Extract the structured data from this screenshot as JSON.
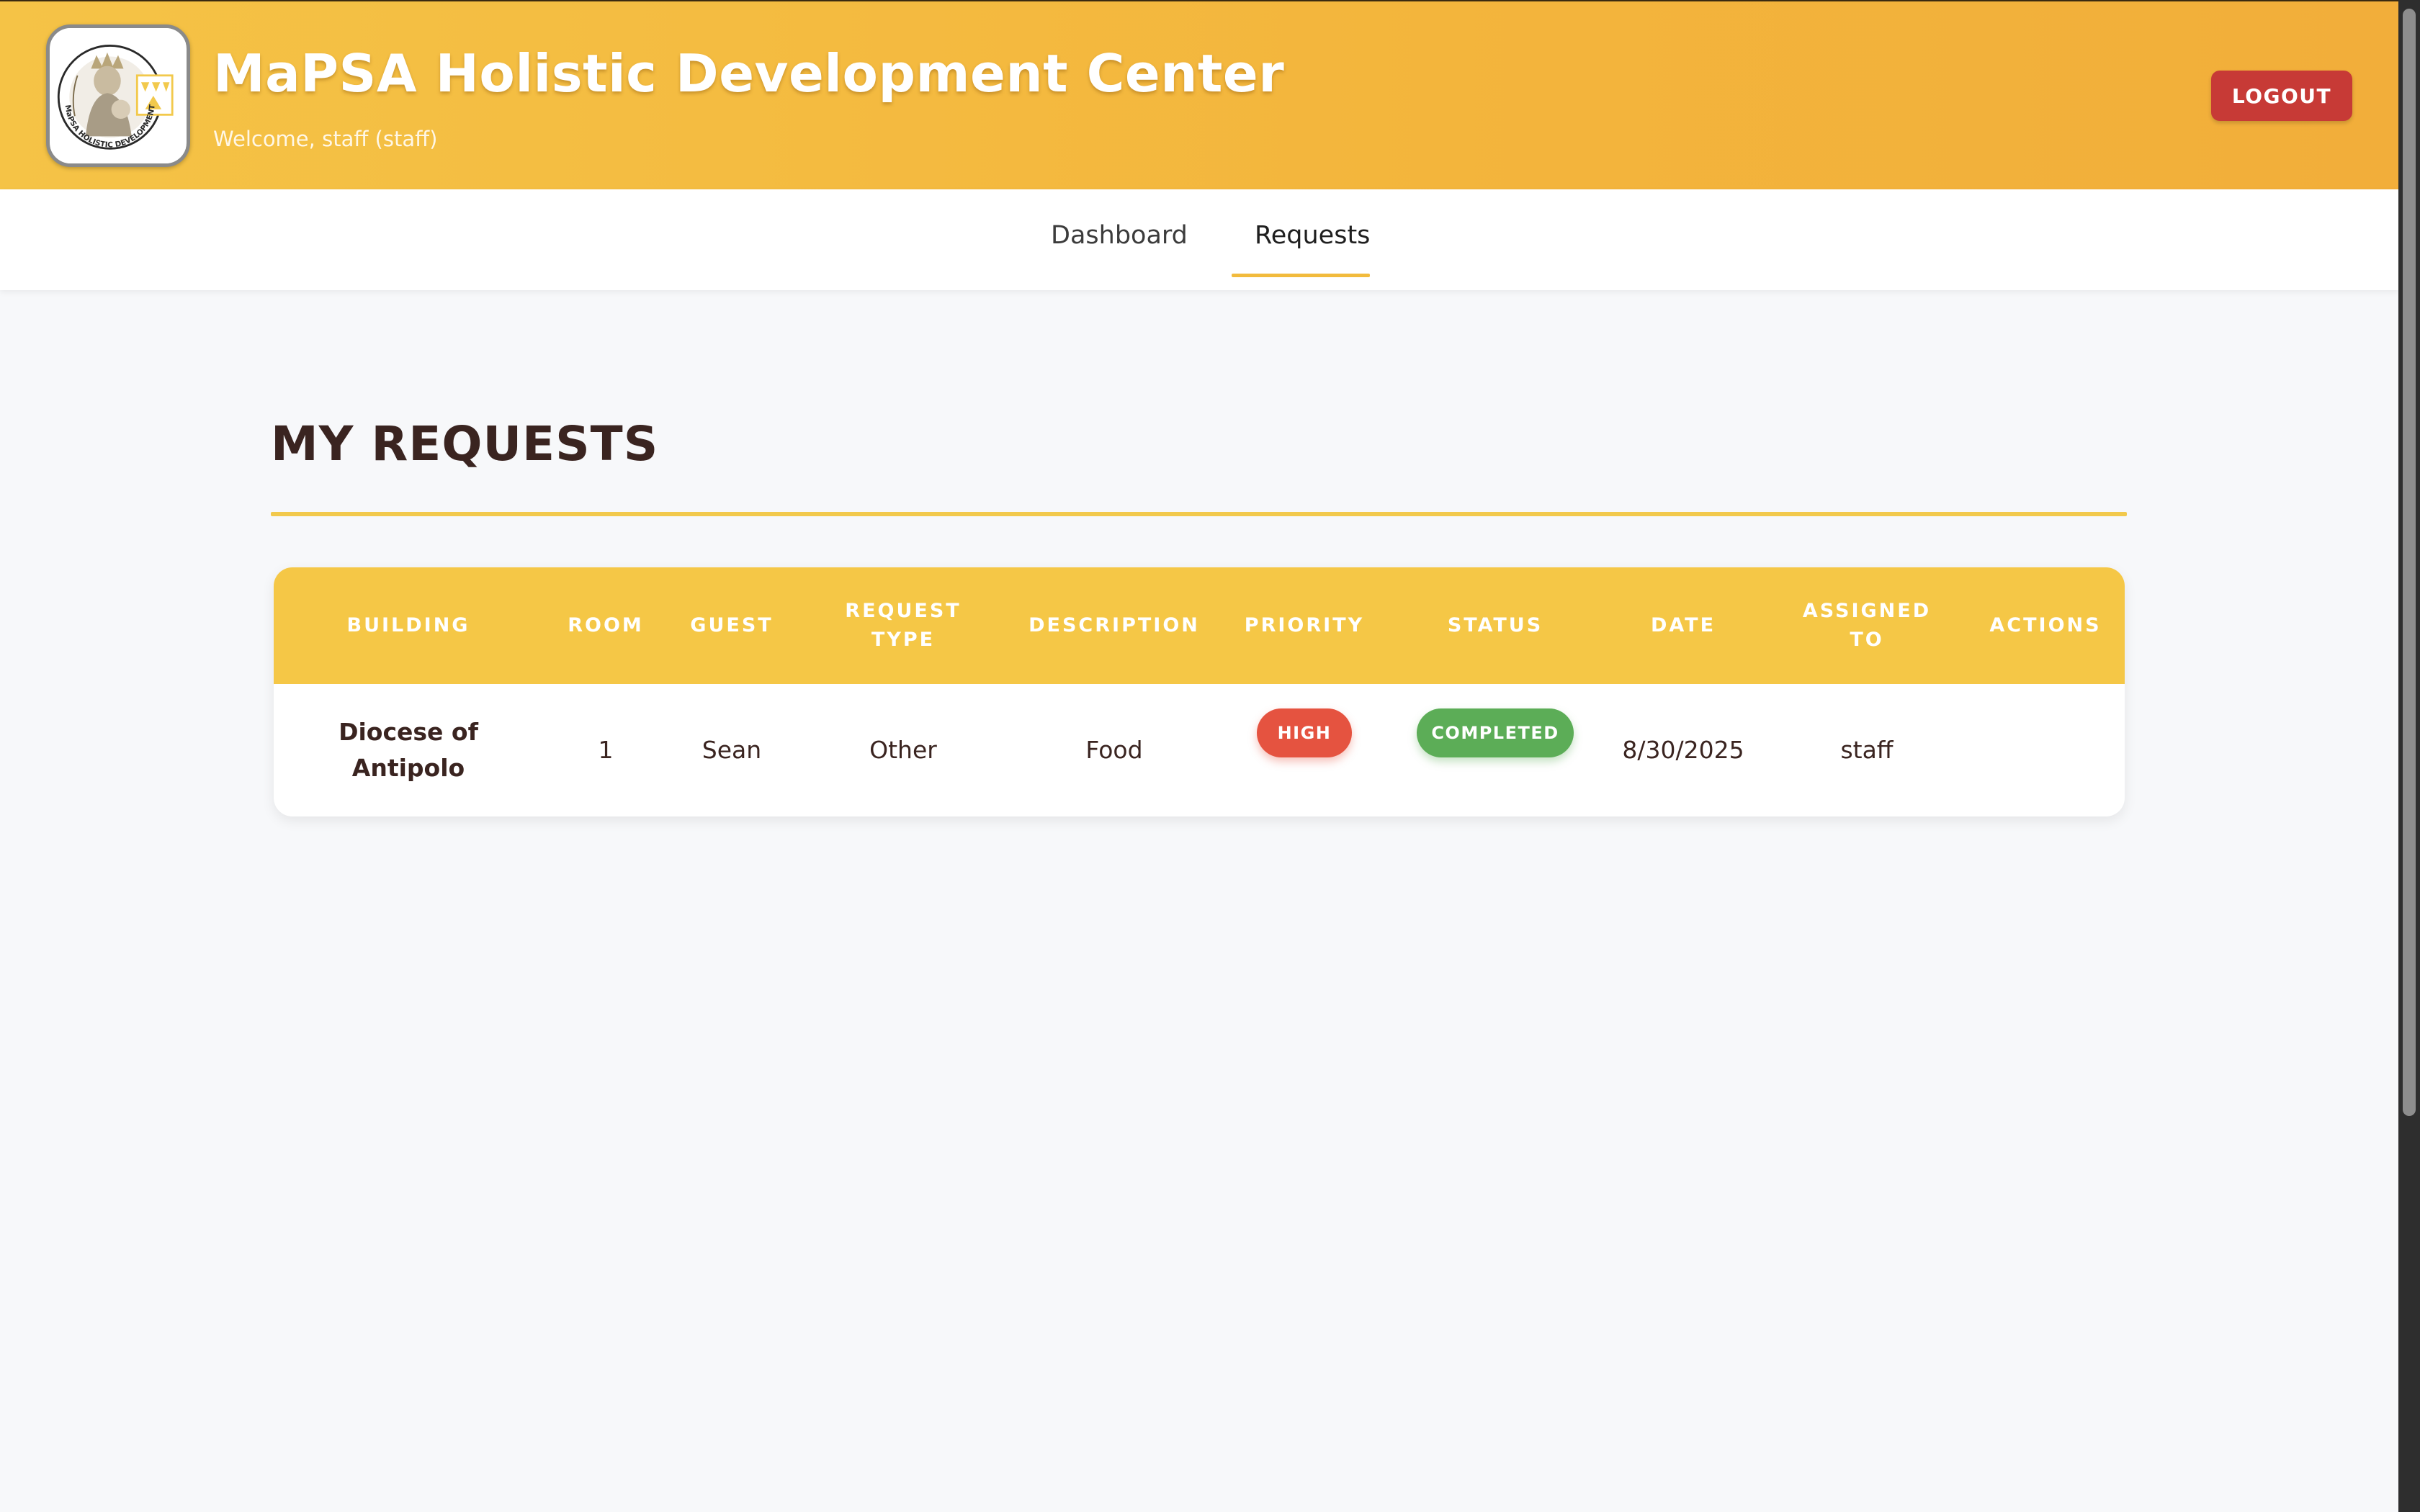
{
  "header": {
    "app_title": "MaPSA Holistic Development Center",
    "welcome_text": "Welcome, staff (staff)",
    "logout_label": "LOGOUT",
    "logo_text": "MaPSA HOLISTIC DEVELOPMENT CENTER",
    "brand_color": "#f5c346",
    "logout_color": "#c73a36"
  },
  "nav": {
    "tabs": [
      {
        "label": "Dashboard",
        "active": false
      },
      {
        "label": "Requests",
        "active": true
      }
    ]
  },
  "main": {
    "page_title": "MY REQUESTS",
    "table": {
      "columns": [
        "BUILDING",
        "ROOM",
        "GUEST",
        "REQUEST TYPE",
        "DESCRIPTION",
        "PRIORITY",
        "STATUS",
        "DATE",
        "ASSIGNED TO",
        "ACTIONS"
      ],
      "rows": [
        {
          "building": "Diocese of Antipolo",
          "room": "1",
          "guest": "Sean",
          "request_type": "Other",
          "description": "Food",
          "priority": "HIGH",
          "status": "COMPLETED",
          "date": "8/30/2025",
          "assigned_to": "staff",
          "actions": ""
        }
      ]
    },
    "priority_color": "#e55340",
    "status_color": "#5cad57"
  }
}
